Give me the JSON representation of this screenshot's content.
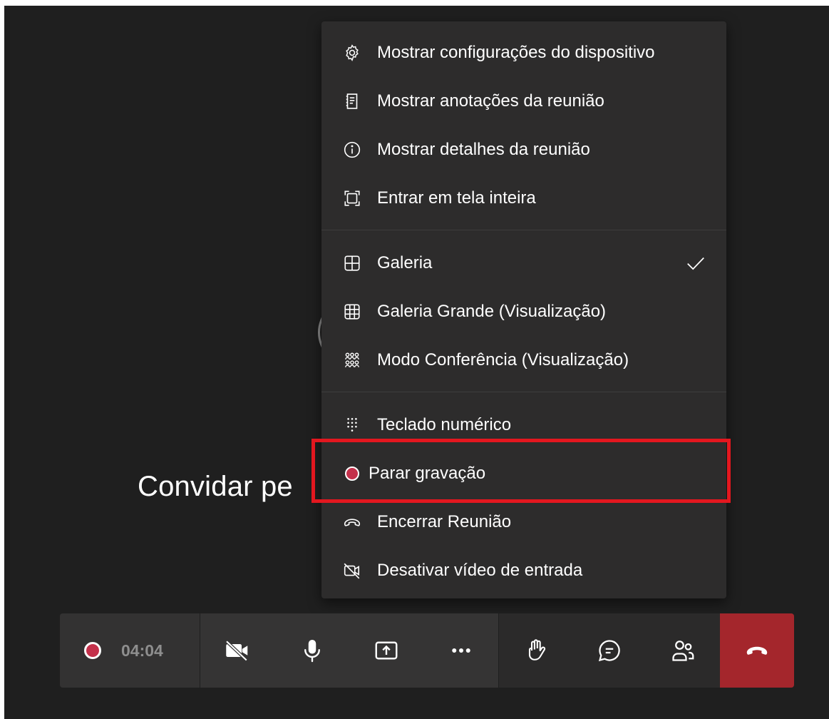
{
  "stage": {
    "invite_text": "Convidar pe"
  },
  "menu": {
    "groups": [
      {
        "items": [
          {
            "label": "Mostrar configurações do dispositivo",
            "icon": "gear-icon"
          },
          {
            "label": "Mostrar anotações da reunião",
            "icon": "notes-icon"
          },
          {
            "label": "Mostrar detalhes da reunião",
            "icon": "info-icon"
          },
          {
            "label": "Entrar em tela inteira",
            "icon": "fullscreen-icon"
          }
        ]
      },
      {
        "items": [
          {
            "label": "Galeria",
            "icon": "grid-2x2-icon",
            "checked": true
          },
          {
            "label": "Galeria Grande (Visualização)",
            "icon": "grid-3x3-icon"
          },
          {
            "label": "Modo Conferência (Visualização)",
            "icon": "people-group-icon"
          }
        ]
      },
      {
        "items": [
          {
            "label": "Teclado numérico",
            "icon": "dialpad-icon"
          },
          {
            "label": "Parar gravação",
            "icon": "record-icon",
            "highlighted": true
          },
          {
            "label": "Encerrar Reunião",
            "icon": "hangup-icon"
          },
          {
            "label": "Desativar vídeo de entrada",
            "icon": "video-off-icon"
          }
        ]
      }
    ]
  },
  "toolbar": {
    "recording_time": "04:04",
    "buttons": [
      "camera-off-icon",
      "microphone-icon",
      "share-screen-icon",
      "more-icon",
      "raise-hand-icon",
      "chat-icon",
      "participants-icon",
      "hangup-icon"
    ]
  },
  "colors": {
    "stage_bg": "#1f1f1f",
    "menu_bg": "#2d2c2c",
    "record_red": "#c4314b",
    "hangup_red": "#a4262c",
    "highlight_red": "#e3171f"
  }
}
